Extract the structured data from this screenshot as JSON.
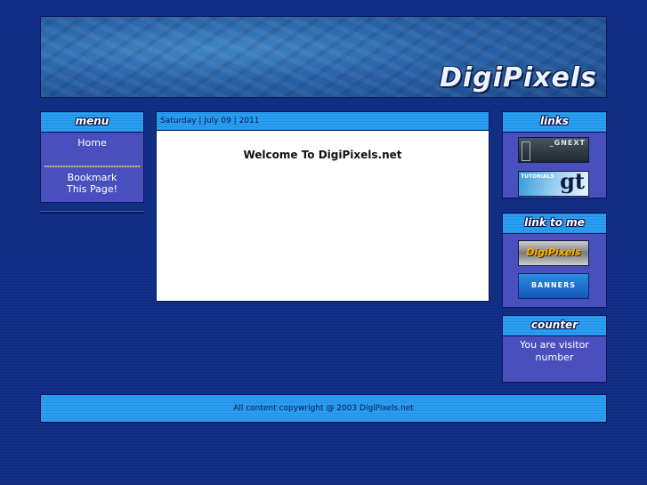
{
  "header": {
    "logo_text": "DigiPixels"
  },
  "menu": {
    "title": "menu",
    "items": [
      {
        "label": "Home"
      },
      {
        "label": "Bookmark This Page!"
      }
    ]
  },
  "main": {
    "date_text": "Saturday | July 09 | 2011",
    "welcome_text": "Welcome To DigiPixels.net"
  },
  "links": {
    "title": "links",
    "buttons": [
      {
        "label": "_GNEXT"
      },
      {
        "label_small": "TUTORIALS",
        "label_big": "gt"
      }
    ]
  },
  "link_to_me": {
    "title": "link to me",
    "buttons": [
      {
        "label": "DigiPixels"
      },
      {
        "label": "BANNERS"
      }
    ]
  },
  "counter": {
    "title": "counter",
    "text": "You are visitor number"
  },
  "footer": {
    "copyright": "All content copywright @ 2003 DigiPixels.net"
  },
  "colors": {
    "page_bg": "#12308a",
    "panel": "#4a4fbe",
    "bar": "#2aa0f4"
  }
}
